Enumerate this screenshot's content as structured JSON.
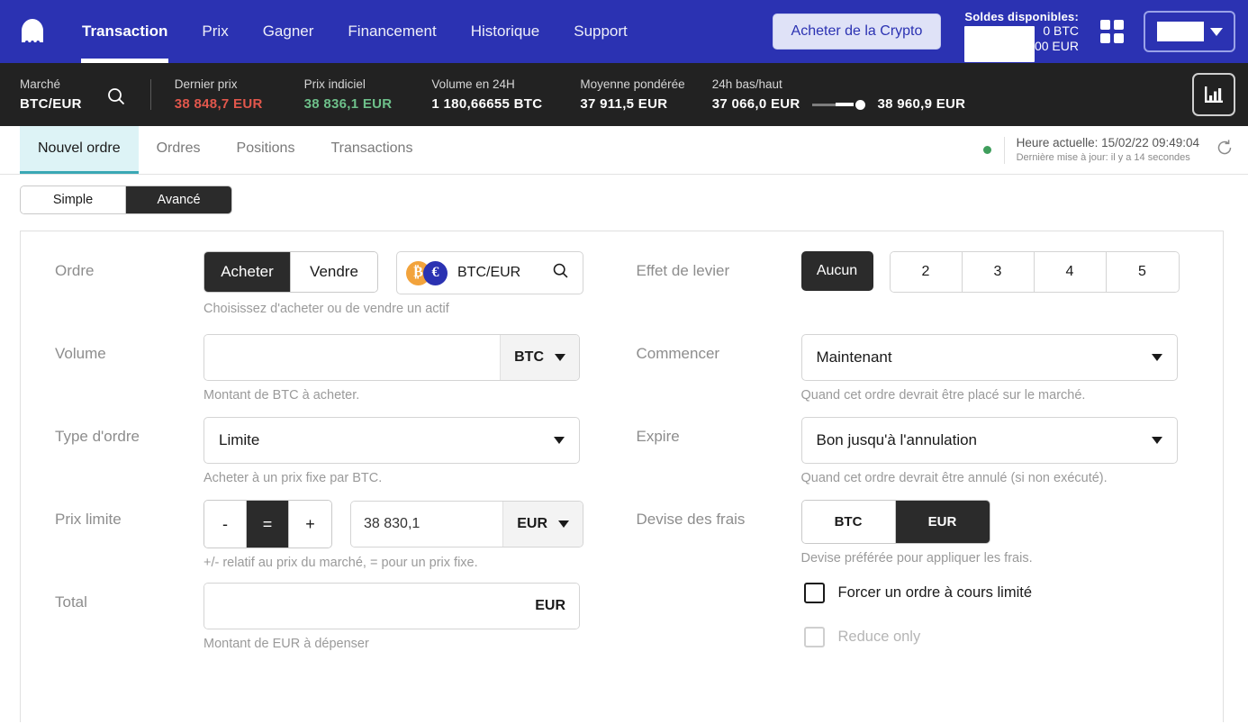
{
  "topnav": {
    "logo_icon": "kraken-logo-icon",
    "links": [
      {
        "label": "Transaction",
        "active": true
      },
      {
        "label": "Prix",
        "active": false
      },
      {
        "label": "Gagner",
        "active": false
      },
      {
        "label": "Financement",
        "active": false
      },
      {
        "label": "Historique",
        "active": false
      },
      {
        "label": "Support",
        "active": false
      }
    ],
    "buy_crypto_label": "Acheter de la Crypto",
    "balances_title": "Soldes disponibles:",
    "balance_btc": "BTC",
    "balance_eur": "EUR",
    "balance_btc_partial": "0 BTC",
    "balance_eur_partial": ",00 EUR",
    "grid_icon": "grid-apps-icon",
    "account_caret_icon": "chevron-down-icon"
  },
  "marketbar": {
    "market_label": "Marché",
    "market_value": "BTC/EUR",
    "search_icon": "search-icon",
    "stats": [
      {
        "label": "Dernier prix",
        "value": "38 848,7  EUR",
        "color": "#e2574c"
      },
      {
        "label": "Prix indiciel",
        "value": "38 836,1  EUR",
        "color": "#6ec08a"
      },
      {
        "label": "Volume en 24H",
        "value": "1 180,66655  BTC",
        "color": "#ffffff"
      },
      {
        "label": "Moyenne pondérée",
        "value": "37 911,5  EUR",
        "color": "#ffffff"
      }
    ],
    "range_label": "24h bas/haut",
    "range_low": "37 066,0  EUR",
    "range_high": "38 960,9  EUR",
    "chart_icon": "bar-chart-icon"
  },
  "tabs": [
    {
      "label": "Nouvel ordre",
      "active": true
    },
    {
      "label": "Ordres",
      "active": false
    },
    {
      "label": "Positions",
      "active": false
    },
    {
      "label": "Transactions",
      "active": false
    }
  ],
  "status": {
    "current_time": "Heure actuelle: 15/02/22 09:49:04",
    "last_update": "Dernière mise à jour: il y a 14 secondes",
    "refresh_icon": "refresh-icon",
    "online_dot_color": "#3f9e5c"
  },
  "mode_switch": {
    "simple_label": "Simple",
    "advanced_label": "Avancé",
    "selected": "Avancé"
  },
  "form": {
    "order": {
      "label": "Ordre",
      "buy_label": "Acheter",
      "sell_label": "Vendre",
      "selected": "Acheter",
      "pair_label": "BTC/EUR",
      "pair_search_icon": "search-icon",
      "base_coin_icon": "bitcoin-coin-icon",
      "quote_coin_icon": "euro-coin-icon",
      "base_coin_glyph": "₿",
      "quote_coin_glyph": "€",
      "hint": "Choisissez d'acheter ou de vendre un actif"
    },
    "leverage": {
      "label": "Effet de levier",
      "none_label": "Aucun",
      "options": [
        "2",
        "3",
        "4",
        "5"
      ],
      "selected": "Aucun"
    },
    "volume": {
      "label": "Volume",
      "value": "",
      "placeholder": "",
      "unit": "BTC",
      "hint": "Montant de BTC à acheter."
    },
    "start": {
      "label": "Commencer",
      "value": "Maintenant",
      "hint": "Quand cet ordre devrait être placé sur le marché."
    },
    "order_type": {
      "label": "Type d'ordre",
      "value": "Limite",
      "hint": "Acheter à un prix fixe par BTC."
    },
    "expire": {
      "label": "Expire",
      "value": "Bon jusqu'à l'annulation",
      "hint": "Quand cet ordre devrait être annulé (si non exécuté)."
    },
    "limit_price": {
      "label": "Prix limite",
      "minus_label": "-",
      "equals_label": "=",
      "plus_label": "+",
      "selected_mode": "=",
      "value": "38 830,1",
      "unit": "EUR",
      "hint": "+/- relatif au prix du marché, = pour un prix fixe."
    },
    "fee_currency": {
      "label": "Devise des frais",
      "options": [
        "BTC",
        "EUR"
      ],
      "selected": "EUR",
      "hint": "Devise préférée pour appliquer les frais."
    },
    "total": {
      "label": "Total",
      "value": "",
      "unit": "EUR",
      "hint": "Montant de EUR à dépenser"
    },
    "checkboxes": [
      {
        "label": "Forcer un ordre à cours limité",
        "checked": false,
        "disabled": false
      },
      {
        "label": "Reduce only",
        "checked": false,
        "disabled": true
      }
    ]
  },
  "colors": {
    "brand_blue": "#2b32b2",
    "dark_bar": "#222222",
    "active_tab_bg": "#ddf3f6",
    "active_tab_border": "#3aa8b5",
    "up_green": "#6ec08a",
    "down_red": "#e2574c",
    "selected_dark": "#2b2b2b"
  }
}
